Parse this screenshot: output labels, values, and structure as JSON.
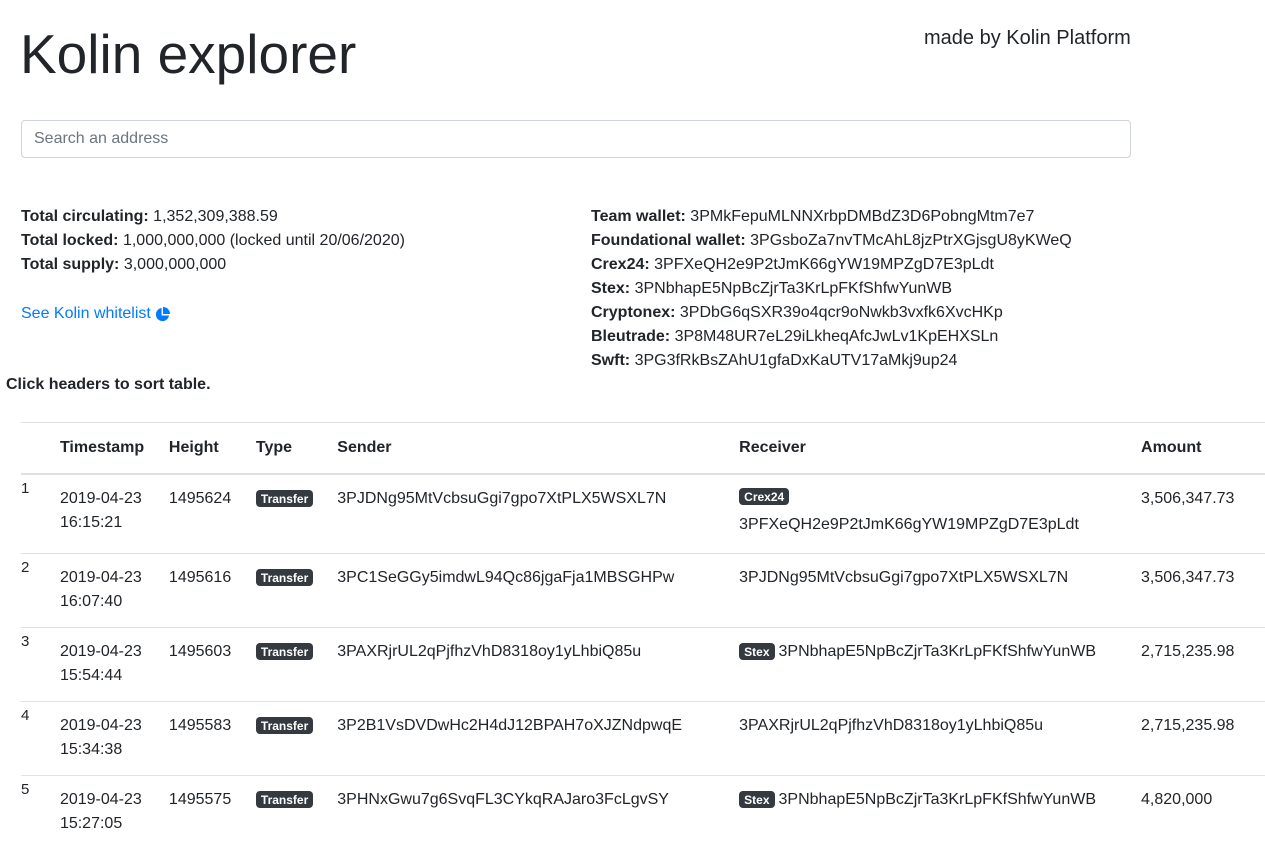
{
  "header": {
    "title": "Kolin explorer",
    "made_by": "made by Kolin Platform"
  },
  "search": {
    "placeholder": "Search an address",
    "value": ""
  },
  "stats": {
    "circulating_label": "Total circulating:",
    "circulating_value": "1,352,309,388.59",
    "locked_label": "Total locked:",
    "locked_value": "1,000,000,000 (locked until 20/06/2020)",
    "supply_label": "Total supply:",
    "supply_value": "3,000,000,000"
  },
  "wallets": [
    {
      "label": "Team wallet:",
      "address": "3PMkFepuMLNNXrbpDMBdZ3D6PobngMtm7e7"
    },
    {
      "label": "Foundational wallet:",
      "address": "3PGsboZa7nvTMcAhL8jzPtrXGjsgU8yKWeQ"
    },
    {
      "label": "Crex24:",
      "address": "3PFXeQH2e9P2tJmK66gYW19MPZgD7E3pLdt"
    },
    {
      "label": "Stex:",
      "address": "3PNbhapE5NpBcZjrTa3KrLpFKfShfwYunWB"
    },
    {
      "label": "Cryptonex:",
      "address": "3PDbG6qSXR39o4qcr9oNwkb3vxfk6XvcHKp"
    },
    {
      "label": "Bleutrade:",
      "address": "3P8M48UR7eL29iLkheqAfcJwLv1KpEHXSLn"
    },
    {
      "label": "Swft:",
      "address": "3PG3fRkBsZAhU1gfaDxKaUTV17aMkj9up24"
    }
  ],
  "whitelist_link": "See Kolin whitelist",
  "sort_hint": "Click headers to sort table.",
  "table": {
    "headers": {
      "timestamp": "Timestamp",
      "height": "Height",
      "type": "Type",
      "sender": "Sender",
      "receiver": "Receiver",
      "amount": "Amount"
    },
    "rows": [
      {
        "index": "1",
        "date": "2019-04-23",
        "time": "16:15:21",
        "height": "1495624",
        "type": "Transfer",
        "sender": "3PJDNg95MtVcbsuGgi7gpo7XtPLX5WSXL7N",
        "receiver_tag": "Crex24",
        "receiver": "3PFXeQH2e9P2tJmK66gYW19MPZgD7E3pLdt",
        "amount": "3,506,347.73"
      },
      {
        "index": "2",
        "date": "2019-04-23",
        "time": "16:07:40",
        "height": "1495616",
        "type": "Transfer",
        "sender": "3PC1SeGGy5imdwL94Qc86jgaFja1MBSGHPw",
        "receiver_tag": "",
        "receiver": "3PJDNg95MtVcbsuGgi7gpo7XtPLX5WSXL7N",
        "amount": "3,506,347.73"
      },
      {
        "index": "3",
        "date": "2019-04-23",
        "time": "15:54:44",
        "height": "1495603",
        "type": "Transfer",
        "sender": "3PAXRjrUL2qPjfhzVhD8318oy1yLhbiQ85u",
        "receiver_tag": "Stex",
        "receiver": "3PNbhapE5NpBcZjrTa3KrLpFKfShfwYunWB",
        "amount": "2,715,235.98"
      },
      {
        "index": "4",
        "date": "2019-04-23",
        "time": "15:34:38",
        "height": "1495583",
        "type": "Transfer",
        "sender": "3P2B1VsDVDwHc2H4dJ12BPAH7oXJZNdpwqE",
        "receiver_tag": "",
        "receiver": "3PAXRjrUL2qPjfhzVhD8318oy1yLhbiQ85u",
        "amount": "2,715,235.98"
      },
      {
        "index": "5",
        "date": "2019-04-23",
        "time": "15:27:05",
        "height": "1495575",
        "type": "Transfer",
        "sender": "3PHNxGwu7g6SvqFL3CYkqRAJaro3FcLgvSY",
        "receiver_tag": "Stex",
        "receiver": "3PNbhapE5NpBcZjrTa3KrLpFKfShfwYunWB",
        "amount": "4,820,000"
      }
    ]
  },
  "colors": {
    "link": "#007bff",
    "badge_bg": "#343a40",
    "border": "#dee2e6"
  },
  "icons": {
    "whitelist_icon": "pie-chart-icon"
  }
}
